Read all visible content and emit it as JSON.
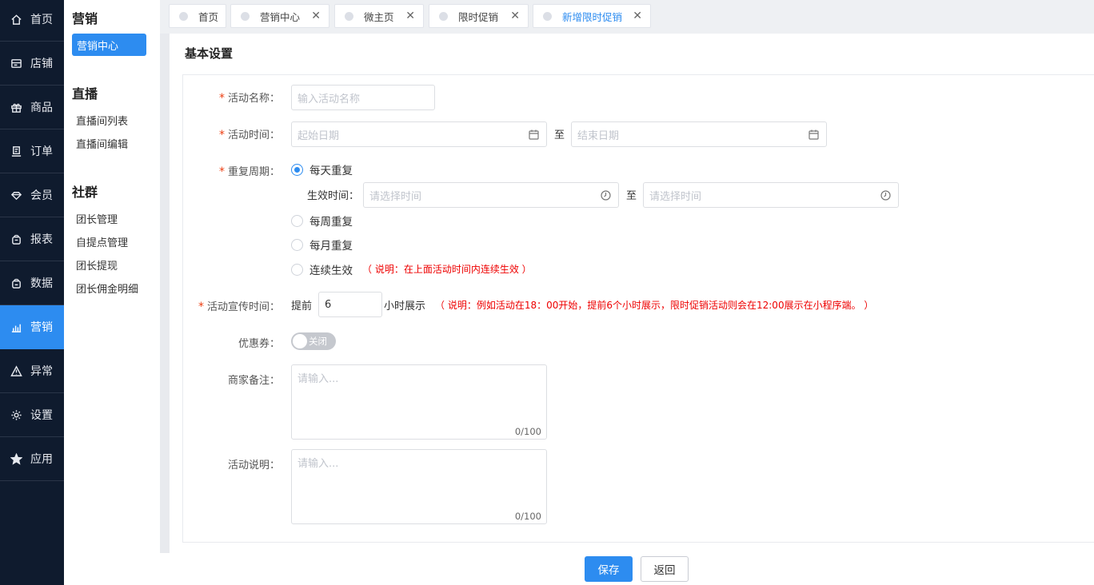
{
  "nav": {
    "items": [
      {
        "label": "首页",
        "icon": "home-icon"
      },
      {
        "label": "店铺",
        "icon": "store-icon"
      },
      {
        "label": "商品",
        "icon": "gift-icon"
      },
      {
        "label": "订单",
        "icon": "order-icon"
      },
      {
        "label": "会员",
        "icon": "member-icon"
      },
      {
        "label": "报表",
        "icon": "report-icon"
      },
      {
        "label": "数据",
        "icon": "data-icon"
      },
      {
        "label": "营销",
        "icon": "marketing-icon"
      },
      {
        "label": "异常",
        "icon": "warning-icon"
      },
      {
        "label": "设置",
        "icon": "gear-icon"
      },
      {
        "label": "应用",
        "icon": "star-icon"
      }
    ],
    "active": "营销"
  },
  "submenu": {
    "groups": [
      {
        "title": "营销",
        "items": [
          "营销中心"
        ]
      },
      {
        "title": "直播",
        "items": [
          "直播间列表",
          "直播间编辑"
        ]
      },
      {
        "title": "社群",
        "items": [
          "团长管理",
          "自提点管理",
          "团长提现",
          "团长佣金明细"
        ]
      }
    ],
    "active": "营销中心"
  },
  "tabs": [
    {
      "label": "首页",
      "closable": false
    },
    {
      "label": "营销中心",
      "closable": true
    },
    {
      "label": "微主页",
      "closable": true
    },
    {
      "label": "限时促销",
      "closable": true
    },
    {
      "label": "新增限时促销",
      "closable": true,
      "active": true
    }
  ],
  "tab_close_glyph": "✕",
  "form": {
    "section_title": "基本设置",
    "name": {
      "label": "活动名称：",
      "placeholder": "输入活动名称"
    },
    "time": {
      "label": "活动时间：",
      "start_placeholder": "起始日期",
      "separator": "至",
      "end_placeholder": "结束日期"
    },
    "repeat": {
      "label": "重复周期：",
      "options": [
        "每天重复",
        "每周重复",
        "每月重复",
        "连续生效"
      ],
      "selected": "每天重复",
      "effective_label": "生效时间：",
      "effective_start_placeholder": "请选择时间",
      "effective_separator": "至",
      "effective_end_placeholder": "请选择时间",
      "continuous_note": "（ 说明：在上面活动时间内连续生效 ）"
    },
    "promo_time": {
      "label": "活动宣传时间：",
      "prefix": "提前",
      "value": "6",
      "suffix": "小时展示",
      "note": "（ 说明：例如活动在18：00开始，提前6个小时展示，限时促销活动则会在12:00展示在小程序端。 ）"
    },
    "coupon": {
      "label": "优惠券：",
      "switch_text": "关闭",
      "on": false
    },
    "merchant_note": {
      "label": "商家备注：",
      "placeholder": "请输入...",
      "count": "0/100"
    },
    "description": {
      "label": "活动说明：",
      "placeholder": "请输入...",
      "count": "0/100"
    },
    "required_mark": "*"
  },
  "actions": {
    "save": "保存",
    "back": "返回"
  },
  "colors": {
    "nav_bg": "#0f1b2e",
    "accent": "#2d8cf0",
    "required": "#ed4014",
    "note": "#e00000"
  }
}
